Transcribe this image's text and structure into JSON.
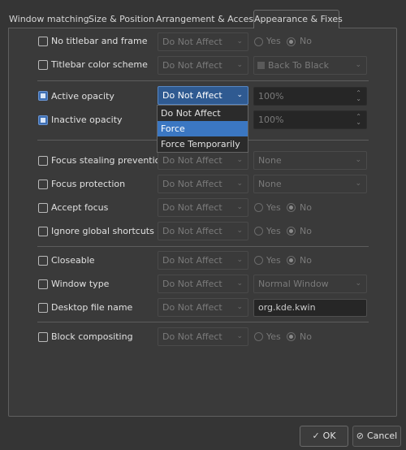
{
  "tabs": [
    {
      "label": "Window matching"
    },
    {
      "label": "Size & Position"
    },
    {
      "label": "Arrangement & Access"
    },
    {
      "label": "Appearance & Fixes"
    }
  ],
  "rows": {
    "no_titlebar": {
      "label": "No titlebar and frame",
      "policy": "Do Not Affect",
      "yes": "Yes",
      "no": "No"
    },
    "titlebar_color": {
      "label": "Titlebar color scheme",
      "policy": "Do Not Affect",
      "value": "Back To Black"
    },
    "active_opacity": {
      "label": "Active opacity",
      "policy": "Do Not Affect",
      "value": "100%",
      "checked": true
    },
    "inactive_opacity": {
      "label": "Inactive opacity",
      "value": "100%",
      "checked": true
    },
    "focus_stealing": {
      "label": "Focus stealing prevention",
      "policy": "Do Not Affect",
      "value": "None"
    },
    "focus_protection": {
      "label": "Focus protection",
      "policy": "Do Not Affect",
      "value": "None"
    },
    "accept_focus": {
      "label": "Accept focus",
      "policy": "Do Not Affect",
      "yes": "Yes",
      "no": "No"
    },
    "ignore_shortcuts": {
      "label": "Ignore global shortcuts",
      "policy": "Do Not Affect",
      "yes": "Yes",
      "no": "No"
    },
    "closeable": {
      "label": "Closeable",
      "policy": "Do Not Affect",
      "yes": "Yes",
      "no": "No"
    },
    "window_type": {
      "label": "Window type",
      "policy": "Do Not Affect",
      "value": "Normal Window"
    },
    "desktop_file": {
      "label": "Desktop file name",
      "policy": "Do Not Affect",
      "value": "org.kde.kwin"
    },
    "block_compositing": {
      "label": "Block compositing",
      "policy": "Do Not Affect",
      "yes": "Yes",
      "no": "No"
    }
  },
  "dropdown": {
    "options": [
      "Do Not Affect",
      "Force",
      "Force Temporarily"
    ],
    "highlighted": "Force"
  },
  "buttons": {
    "ok": "OK",
    "cancel": "Cancel"
  },
  "colors": {
    "accent": "#3b77c2",
    "background": "#353535"
  }
}
